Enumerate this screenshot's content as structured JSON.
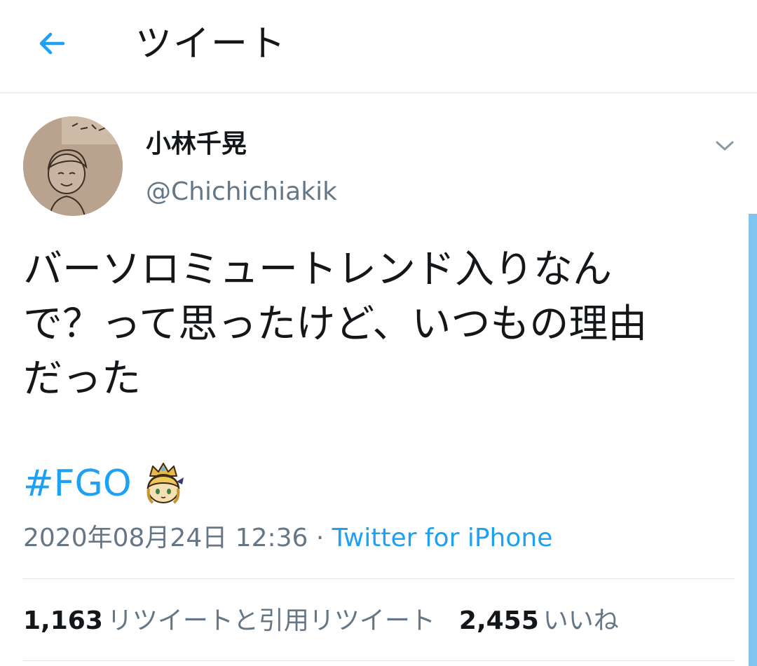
{
  "header": {
    "title": "ツイート",
    "back_icon": "arrow-left-icon",
    "accent_color": "#1da1f2"
  },
  "tweet": {
    "author": {
      "display_name": "小林千晃",
      "handle": "@Chichichiakik"
    },
    "text_lines": [
      "バーソロミュートレンド入りなん",
      "で？って思ったけど、いつもの理由",
      "だった"
    ],
    "hashtag": "#FGO",
    "hashtag_emoji": "saber-chibi-emoji",
    "timestamp": "2020年08月24日 12:36",
    "separator": " · ",
    "source": "Twitter for iPhone"
  },
  "stats": {
    "retweets": "1,163",
    "retweets_label": "リツイートと引用リツイート",
    "likes": "2,455",
    "likes_label": "いいね"
  }
}
